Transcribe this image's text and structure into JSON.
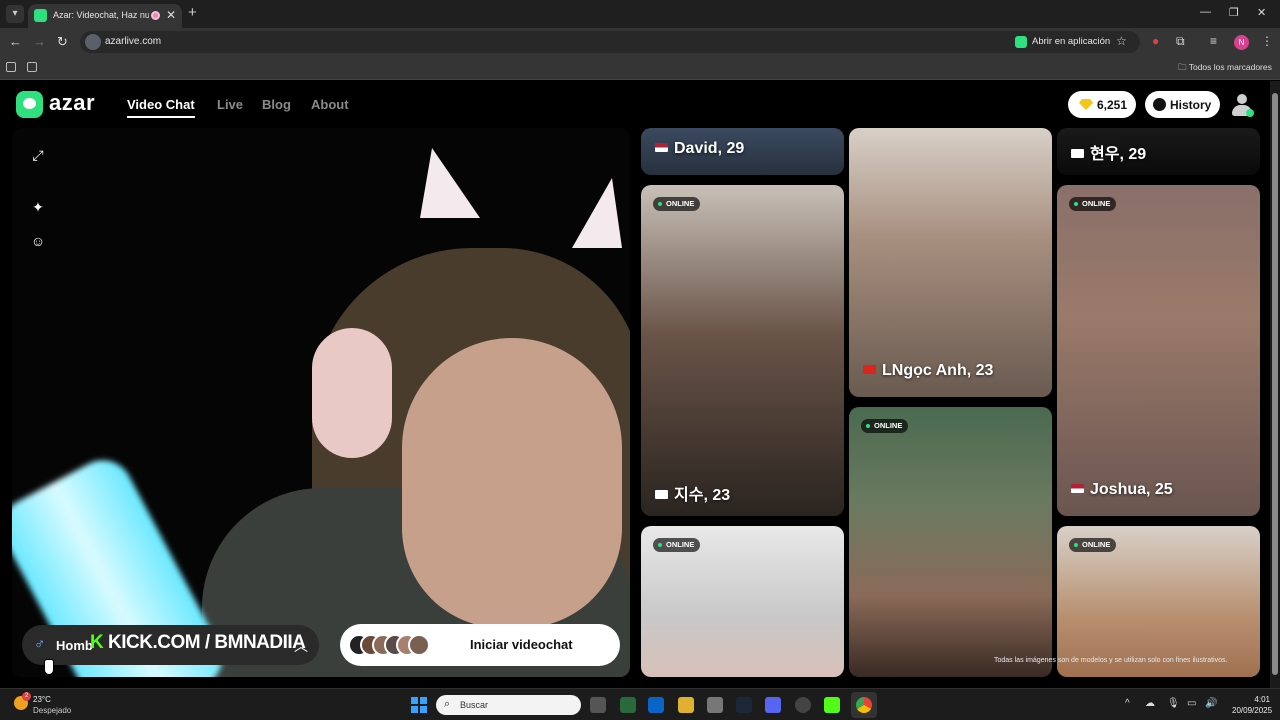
{
  "browser": {
    "tab_title": "Azar: Videochat, Haz nuevos amigos",
    "tab_close": "✕",
    "new_tab": "+",
    "url": "azarlive.com",
    "open_in_app": "Abrir en aplicación",
    "all_bookmarks": "Todos los marcadores",
    "profile_initial": "N"
  },
  "site": {
    "logo_text": "azar",
    "nav": [
      "Video Chat",
      "Live",
      "Blog",
      "About"
    ],
    "gems": "6,251",
    "history_label": "History"
  },
  "video_panel": {
    "gender_prefix": "Homb",
    "stream_watermark": "KICK.COM / BMNADIIA",
    "stream_watermark_k": "K",
    "start_label": "Iniciar videochat"
  },
  "profiles": [
    {
      "name": "David, 29",
      "flag": "US",
      "online": false
    },
    {
      "name": "현우, 29",
      "flag": "KR",
      "online": false
    },
    {
      "name": "지수, 23",
      "flag": "KR",
      "online": true,
      "online_label": "ONLINE"
    },
    {
      "name": "LNgọc Anh, 23",
      "flag": "VN",
      "online": false
    },
    {
      "name": "Joshua, 25",
      "flag": "US",
      "online": true,
      "online_label": "ONLINE"
    },
    {
      "name": "",
      "online": true,
      "online_label": "ONLINE"
    },
    {
      "name": "",
      "online": true,
      "online_label": "ONLINE"
    },
    {
      "name": "",
      "online": true,
      "online_label": "ONLINE"
    }
  ],
  "disclaimer": "Todas las imágenes son de modelos y se utilizan solo con fines ilustrativos.",
  "taskbar": {
    "temperature": "23°C",
    "condition": "Despejado",
    "weather_badge": "2",
    "search_placeholder": "Buscar",
    "time": "4:01",
    "date": "20/09/2025"
  },
  "colors": {
    "brand_green": "#2fe07f",
    "kick_green": "#53fc18",
    "gem_gold": "#f5c518"
  }
}
